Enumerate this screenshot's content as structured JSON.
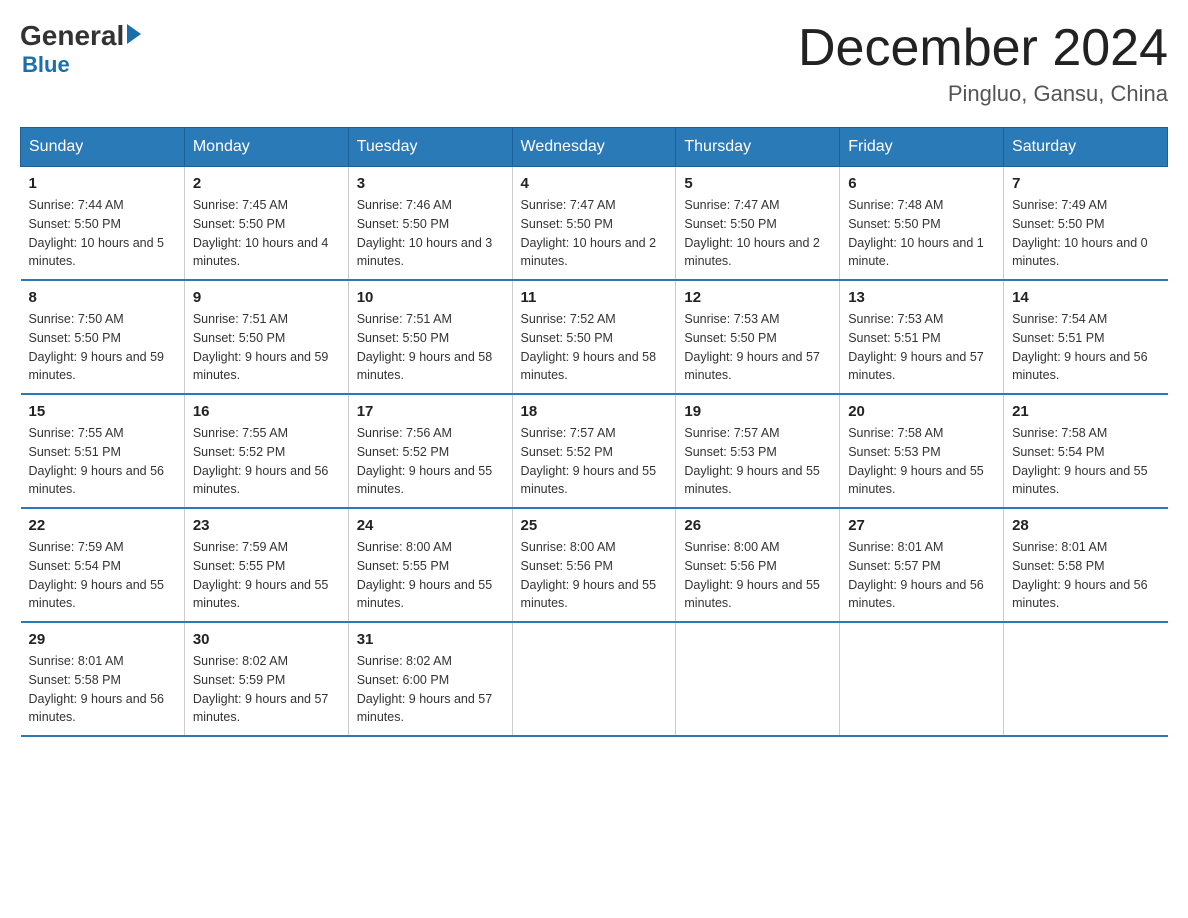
{
  "logo": {
    "general": "General",
    "arrow": "▶",
    "blue": "Blue"
  },
  "title": "December 2024",
  "location": "Pingluo, Gansu, China",
  "days_of_week": [
    "Sunday",
    "Monday",
    "Tuesday",
    "Wednesday",
    "Thursday",
    "Friday",
    "Saturday"
  ],
  "weeks": [
    [
      {
        "day": "1",
        "sunrise": "7:44 AM",
        "sunset": "5:50 PM",
        "daylight": "10 hours and 5 minutes."
      },
      {
        "day": "2",
        "sunrise": "7:45 AM",
        "sunset": "5:50 PM",
        "daylight": "10 hours and 4 minutes."
      },
      {
        "day": "3",
        "sunrise": "7:46 AM",
        "sunset": "5:50 PM",
        "daylight": "10 hours and 3 minutes."
      },
      {
        "day": "4",
        "sunrise": "7:47 AM",
        "sunset": "5:50 PM",
        "daylight": "10 hours and 2 minutes."
      },
      {
        "day": "5",
        "sunrise": "7:47 AM",
        "sunset": "5:50 PM",
        "daylight": "10 hours and 2 minutes."
      },
      {
        "day": "6",
        "sunrise": "7:48 AM",
        "sunset": "5:50 PM",
        "daylight": "10 hours and 1 minute."
      },
      {
        "day": "7",
        "sunrise": "7:49 AM",
        "sunset": "5:50 PM",
        "daylight": "10 hours and 0 minutes."
      }
    ],
    [
      {
        "day": "8",
        "sunrise": "7:50 AM",
        "sunset": "5:50 PM",
        "daylight": "9 hours and 59 minutes."
      },
      {
        "day": "9",
        "sunrise": "7:51 AM",
        "sunset": "5:50 PM",
        "daylight": "9 hours and 59 minutes."
      },
      {
        "day": "10",
        "sunrise": "7:51 AM",
        "sunset": "5:50 PM",
        "daylight": "9 hours and 58 minutes."
      },
      {
        "day": "11",
        "sunrise": "7:52 AM",
        "sunset": "5:50 PM",
        "daylight": "9 hours and 58 minutes."
      },
      {
        "day": "12",
        "sunrise": "7:53 AM",
        "sunset": "5:50 PM",
        "daylight": "9 hours and 57 minutes."
      },
      {
        "day": "13",
        "sunrise": "7:53 AM",
        "sunset": "5:51 PM",
        "daylight": "9 hours and 57 minutes."
      },
      {
        "day": "14",
        "sunrise": "7:54 AM",
        "sunset": "5:51 PM",
        "daylight": "9 hours and 56 minutes."
      }
    ],
    [
      {
        "day": "15",
        "sunrise": "7:55 AM",
        "sunset": "5:51 PM",
        "daylight": "9 hours and 56 minutes."
      },
      {
        "day": "16",
        "sunrise": "7:55 AM",
        "sunset": "5:52 PM",
        "daylight": "9 hours and 56 minutes."
      },
      {
        "day": "17",
        "sunrise": "7:56 AM",
        "sunset": "5:52 PM",
        "daylight": "9 hours and 55 minutes."
      },
      {
        "day": "18",
        "sunrise": "7:57 AM",
        "sunset": "5:52 PM",
        "daylight": "9 hours and 55 minutes."
      },
      {
        "day": "19",
        "sunrise": "7:57 AM",
        "sunset": "5:53 PM",
        "daylight": "9 hours and 55 minutes."
      },
      {
        "day": "20",
        "sunrise": "7:58 AM",
        "sunset": "5:53 PM",
        "daylight": "9 hours and 55 minutes."
      },
      {
        "day": "21",
        "sunrise": "7:58 AM",
        "sunset": "5:54 PM",
        "daylight": "9 hours and 55 minutes."
      }
    ],
    [
      {
        "day": "22",
        "sunrise": "7:59 AM",
        "sunset": "5:54 PM",
        "daylight": "9 hours and 55 minutes."
      },
      {
        "day": "23",
        "sunrise": "7:59 AM",
        "sunset": "5:55 PM",
        "daylight": "9 hours and 55 minutes."
      },
      {
        "day": "24",
        "sunrise": "8:00 AM",
        "sunset": "5:55 PM",
        "daylight": "9 hours and 55 minutes."
      },
      {
        "day": "25",
        "sunrise": "8:00 AM",
        "sunset": "5:56 PM",
        "daylight": "9 hours and 55 minutes."
      },
      {
        "day": "26",
        "sunrise": "8:00 AM",
        "sunset": "5:56 PM",
        "daylight": "9 hours and 55 minutes."
      },
      {
        "day": "27",
        "sunrise": "8:01 AM",
        "sunset": "5:57 PM",
        "daylight": "9 hours and 56 minutes."
      },
      {
        "day": "28",
        "sunrise": "8:01 AM",
        "sunset": "5:58 PM",
        "daylight": "9 hours and 56 minutes."
      }
    ],
    [
      {
        "day": "29",
        "sunrise": "8:01 AM",
        "sunset": "5:58 PM",
        "daylight": "9 hours and 56 minutes."
      },
      {
        "day": "30",
        "sunrise": "8:02 AM",
        "sunset": "5:59 PM",
        "daylight": "9 hours and 57 minutes."
      },
      {
        "day": "31",
        "sunrise": "8:02 AM",
        "sunset": "6:00 PM",
        "daylight": "9 hours and 57 minutes."
      },
      null,
      null,
      null,
      null
    ]
  ],
  "labels": {
    "sunrise": "Sunrise:",
    "sunset": "Sunset:",
    "daylight": "Daylight:"
  }
}
